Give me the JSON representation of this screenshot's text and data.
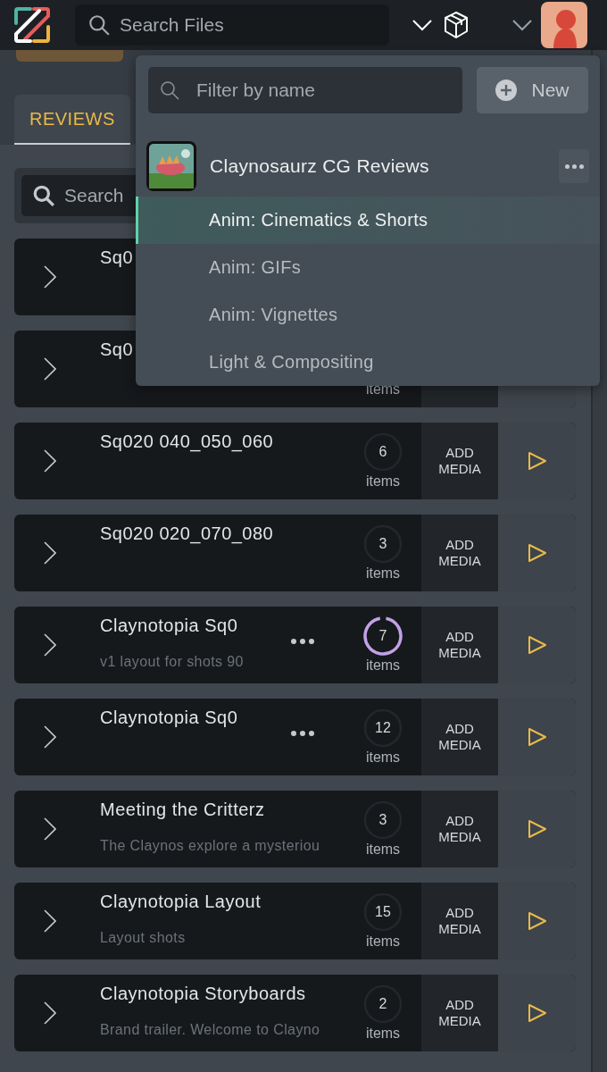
{
  "header": {
    "search": {
      "placeholder": "Search Files"
    }
  },
  "tabs": [
    {
      "label": "REVIEWS",
      "selected": true
    }
  ],
  "review_search": {
    "placeholder": "Search"
  },
  "rows": [
    {
      "title": "Sq0"
    },
    {
      "title": "Sq0",
      "unit": "items"
    },
    {
      "title": "Sq020 040_050_060",
      "count": "6",
      "unit": "items",
      "add_media": "ADD\nMEDIA",
      "menu": false,
      "highlighted": false,
      "play": true
    },
    {
      "title": "Sq020 020_070_080",
      "count": "3",
      "unit": "items",
      "add_media": "ADD\nMEDIA",
      "menu": false,
      "highlighted": false,
      "play": true
    },
    {
      "title": "Claynotopia Sq0",
      "description": "v1 layout for shots 90",
      "count": "7",
      "unit": "items",
      "add_media": "ADD\nMEDIA",
      "menu": true,
      "highlighted": true,
      "play": true
    },
    {
      "title": "Claynotopia Sq0",
      "count": "12",
      "unit": "items",
      "add_media": "ADD\nMEDIA",
      "menu": true,
      "highlighted": false,
      "play": true
    },
    {
      "title": "Meeting the Critterz",
      "description": "The Claynos explore a mysteriou",
      "count": "3",
      "unit": "items",
      "add_media": "ADD\nMEDIA",
      "menu": false,
      "highlighted": false,
      "play": true
    },
    {
      "title": "Claynotopia Layout",
      "description": "Layout shots",
      "count": "15",
      "unit": "items",
      "add_media": "ADD\nMEDIA",
      "menu": false,
      "highlighted": false,
      "play": true
    },
    {
      "title": "Claynotopia Storyboards",
      "description": "Brand trailer. Welcome to Clayno",
      "count": "2",
      "unit": "items",
      "add_media": "ADD\nMEDIA",
      "menu": false,
      "highlighted": false,
      "play": true
    }
  ],
  "dropdown": {
    "filter": {
      "placeholder": "Filter by name"
    },
    "new_button": "New",
    "team": {
      "name": "Claynosaurz CG Reviews"
    },
    "items": [
      {
        "label": "Anim: Cinematics & Shorts",
        "selected": true
      },
      {
        "label": "Anim: GIFs",
        "selected": false
      },
      {
        "label": "Anim: Vignettes",
        "selected": false
      },
      {
        "label": "Light & Compositing",
        "selected": false
      }
    ]
  }
}
